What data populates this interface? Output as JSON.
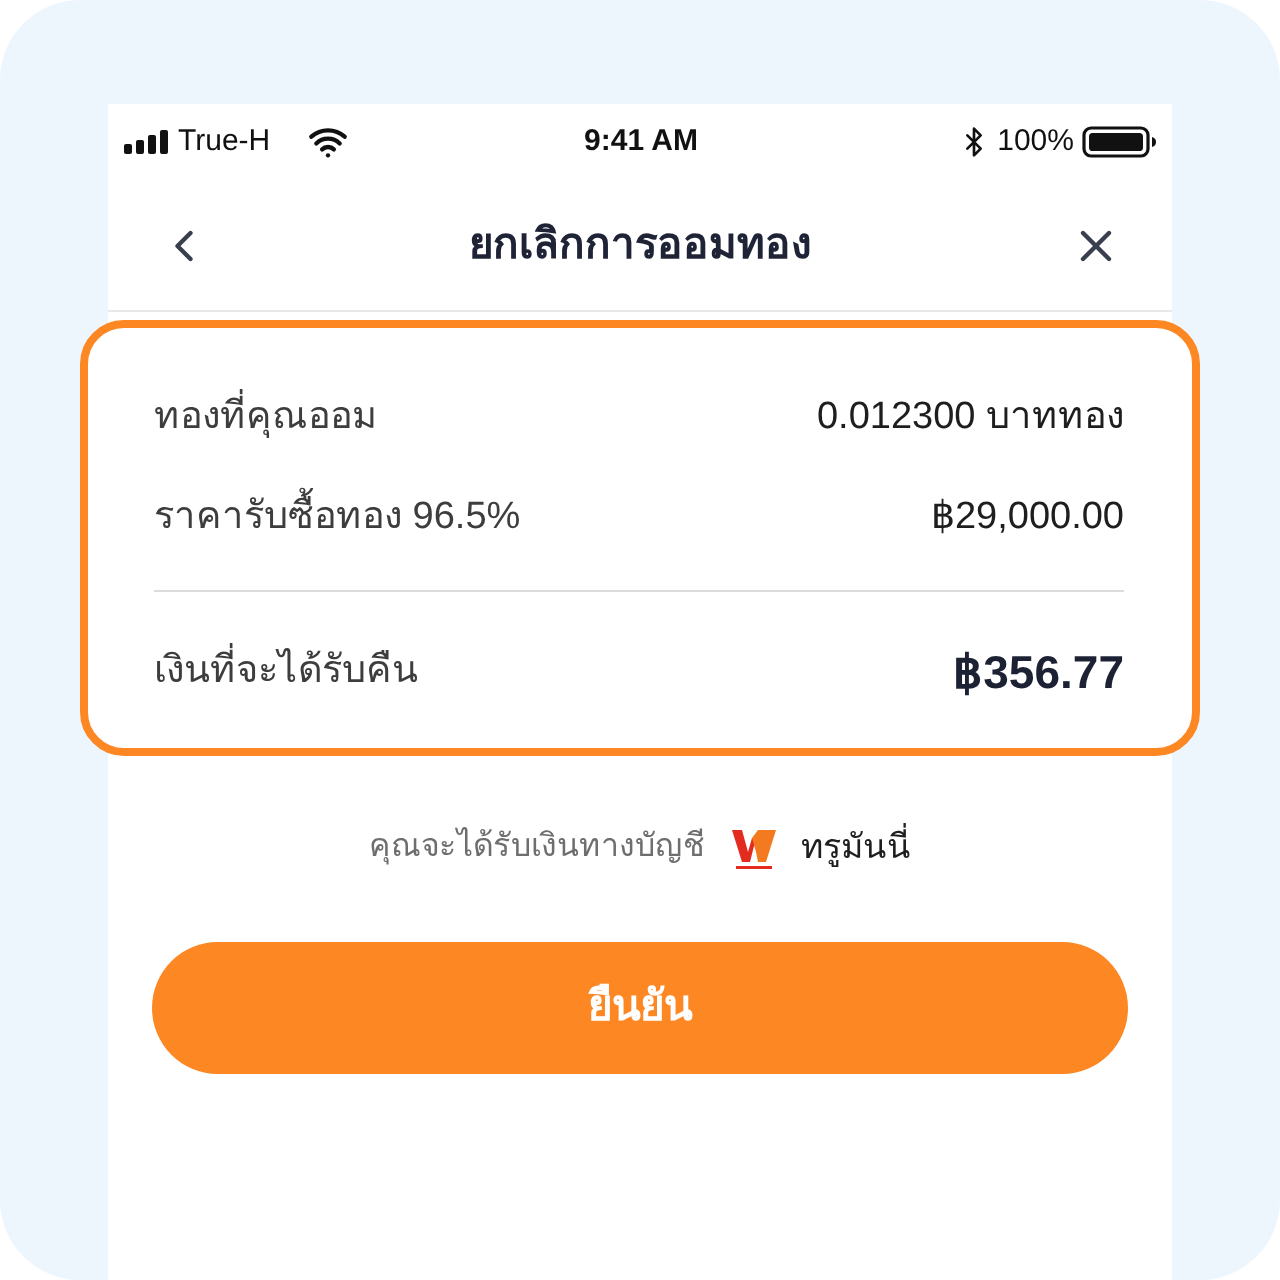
{
  "status_bar": {
    "carrier": "True-H",
    "time": "9:41 AM",
    "battery": "100%"
  },
  "nav": {
    "title": "ยกเลิกการออมทอง"
  },
  "summary": {
    "rows": [
      {
        "label": "ทองที่คุณออม",
        "value": "0.012300 บาททอง"
      },
      {
        "label": "ราคารับซื้อทอง 96.5%",
        "value": "฿29,000.00"
      }
    ],
    "total": {
      "label": "เงินที่จะได้รับคืน",
      "value": "฿356.77"
    }
  },
  "payout": {
    "text": "คุณจะได้รับเงินทางบัญชี",
    "wallet": "ทรูมันนี่"
  },
  "confirm_button": {
    "label": "ยืนยัน"
  }
}
